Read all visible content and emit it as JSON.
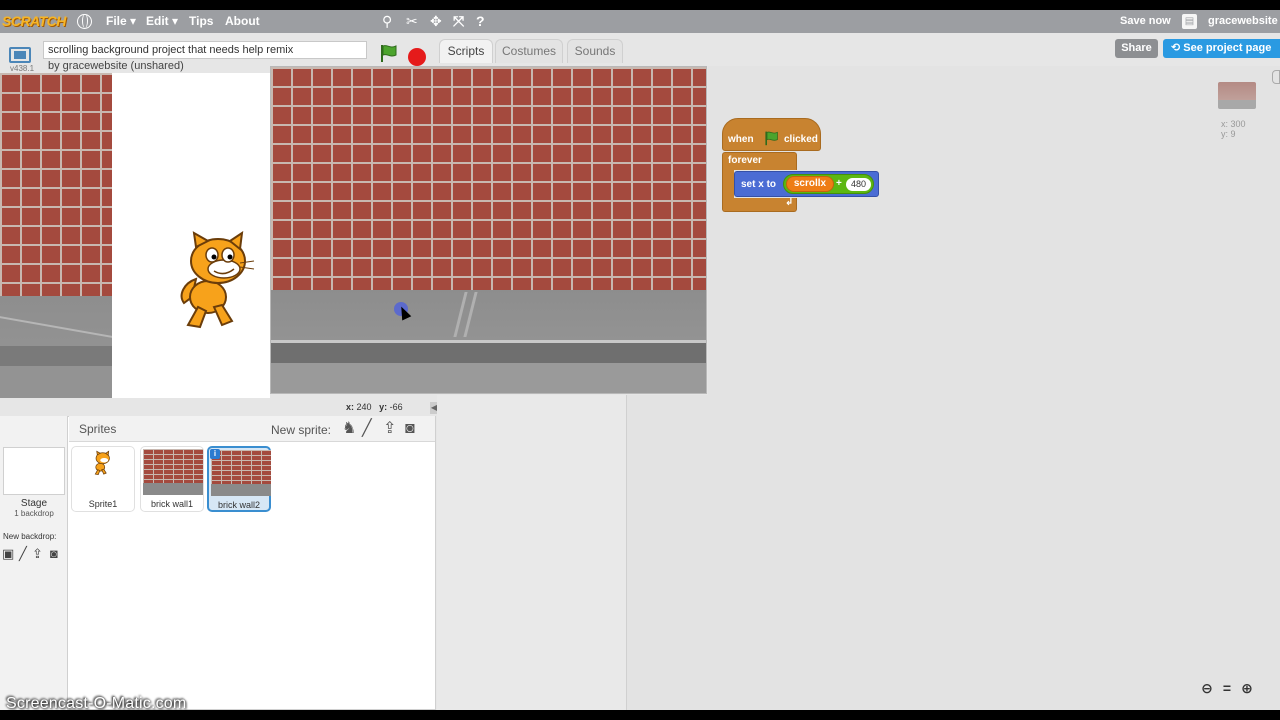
{
  "menu": {
    "logo": "SCRATCH",
    "file": "File ▾",
    "edit": "Edit ▾",
    "tips": "Tips",
    "about": "About",
    "save_now": "Save now",
    "username": "gracewebsite"
  },
  "project": {
    "version": "v438.1",
    "title": "scrolling background project that needs help remix",
    "byline": "by gracewebsite (unshared)"
  },
  "tabs": [
    {
      "label": "Scripts",
      "active": true
    },
    {
      "label": "Costumes",
      "active": false
    },
    {
      "label": "Sounds",
      "active": false
    }
  ],
  "header_buttons": {
    "share": "Share",
    "see_project_page": "See project page"
  },
  "stage": {
    "mouse_x_label": "x:",
    "mouse_x": "240",
    "mouse_y_label": "y:",
    "mouse_y": "-66"
  },
  "sprites_pane": {
    "title": "Sprites",
    "new_sprite": "New sprite:",
    "stage_label": "Stage",
    "stage_sub": "1 backdrop",
    "new_backdrop": "New backdrop:",
    "sprites": [
      {
        "name": "Sprite1",
        "selected": false
      },
      {
        "name": "brick wall1",
        "selected": false
      },
      {
        "name": "brick wall2",
        "selected": true
      }
    ]
  },
  "scripts": {
    "hat_when": "when",
    "hat_clicked": "clicked",
    "forever": "forever",
    "set_x_to": "set x to",
    "variable": "scrollx",
    "operator": "+",
    "number": "480"
  },
  "sprite_info": {
    "x": "x: 300",
    "y": "y: 9"
  },
  "zoom": {
    "out": "🔍",
    "reset": "=",
    "in": "🔍"
  },
  "watermark": "Screencast-O-Matic.com",
  "colors": {
    "menubar": "#9c9ea2",
    "events": "#c88330",
    "motion": "#4a6cd4",
    "variables": "#ee7d16",
    "operators": "#5cb712",
    "accent": "#2a9ae2"
  }
}
